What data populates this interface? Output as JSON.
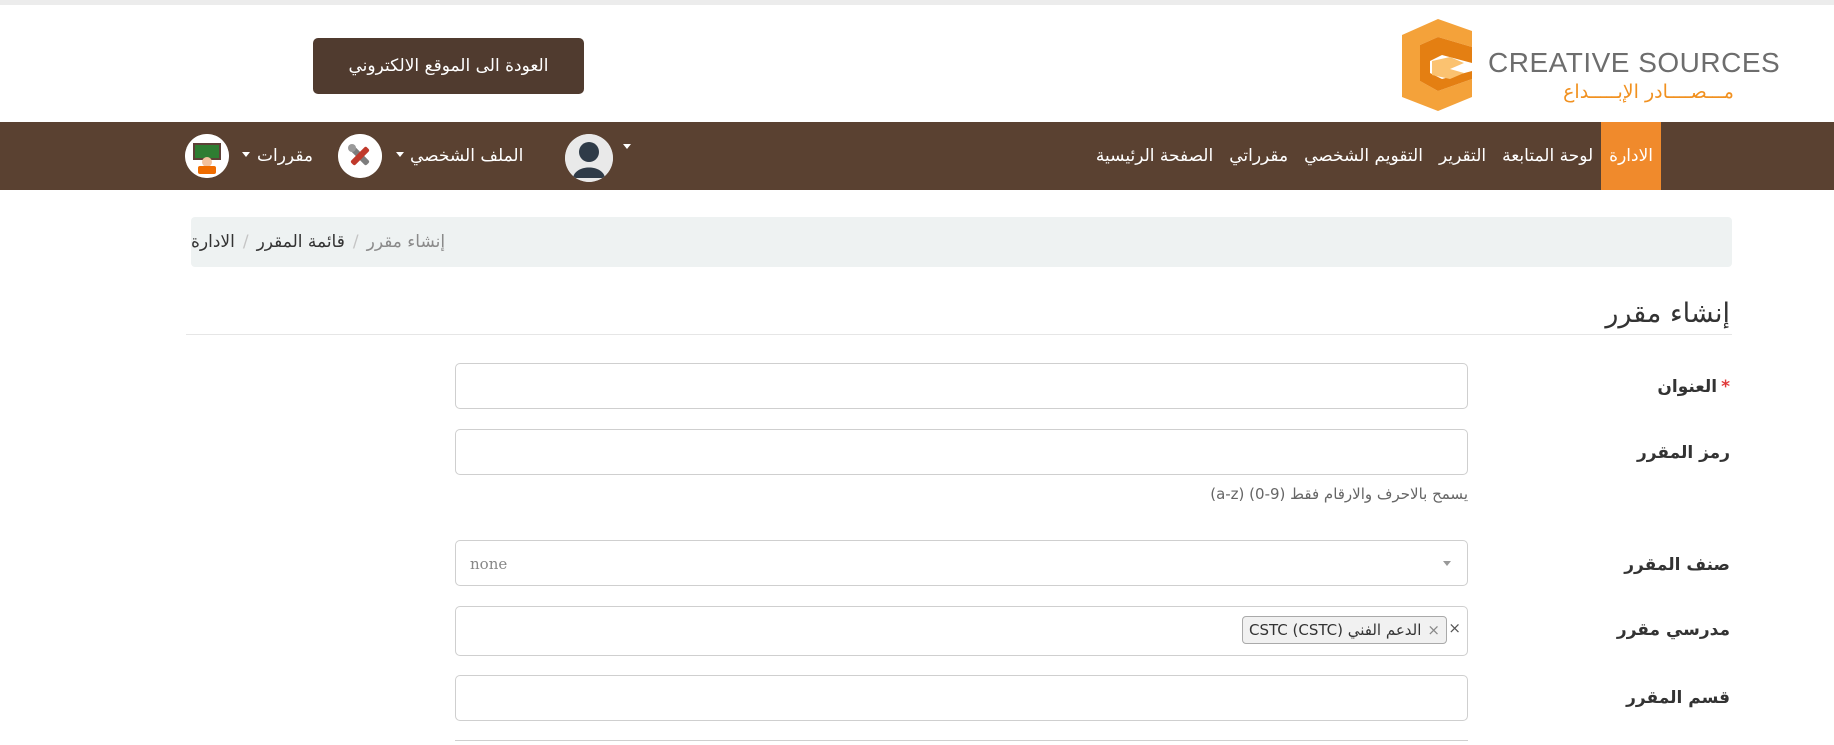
{
  "header": {
    "back_button": "العودة الى الموقع الالكتروني",
    "logo_en": "CREATIVE SOURCES",
    "logo_ar": "مـــصــــادر الإبـــــداع"
  },
  "navbar": {
    "items": [
      {
        "label": "الصفحة الرئيسية"
      },
      {
        "label": "مقرراتي"
      },
      {
        "label": "التقويم الشخصي"
      },
      {
        "label": "التقرير"
      },
      {
        "label": "لوحة المتابعة"
      },
      {
        "label": "الادارة",
        "active": true
      }
    ],
    "profile_label": "الملف الشخصي",
    "courses_label": "مقررات"
  },
  "breadcrumb": {
    "items": [
      "الادارة",
      "قائمة المقرر"
    ],
    "separator": "/",
    "current": "إنشاء مقرر"
  },
  "page_title": "إنشاء مقرر",
  "form": {
    "title_label": "العنوان",
    "required_mark": "*",
    "code_label": "رمز المقرر",
    "code_help": "(a-z) (0-9) يسمح بالاحرف والارقام فقط",
    "category_label": "صنف المقرر",
    "category_value": "none",
    "teachers_label": "مدرسي مقرر",
    "teacher_tag": "الدعم الفني (CSTC) CSTC",
    "teacher_tag_remove": "×",
    "clear_all": "×",
    "department_label": "قسم المقرر"
  },
  "colors": {
    "navbar": "#5a4131",
    "active": "#f08a2c",
    "back_button": "#503b2f",
    "logo_orange": "#f19120"
  }
}
